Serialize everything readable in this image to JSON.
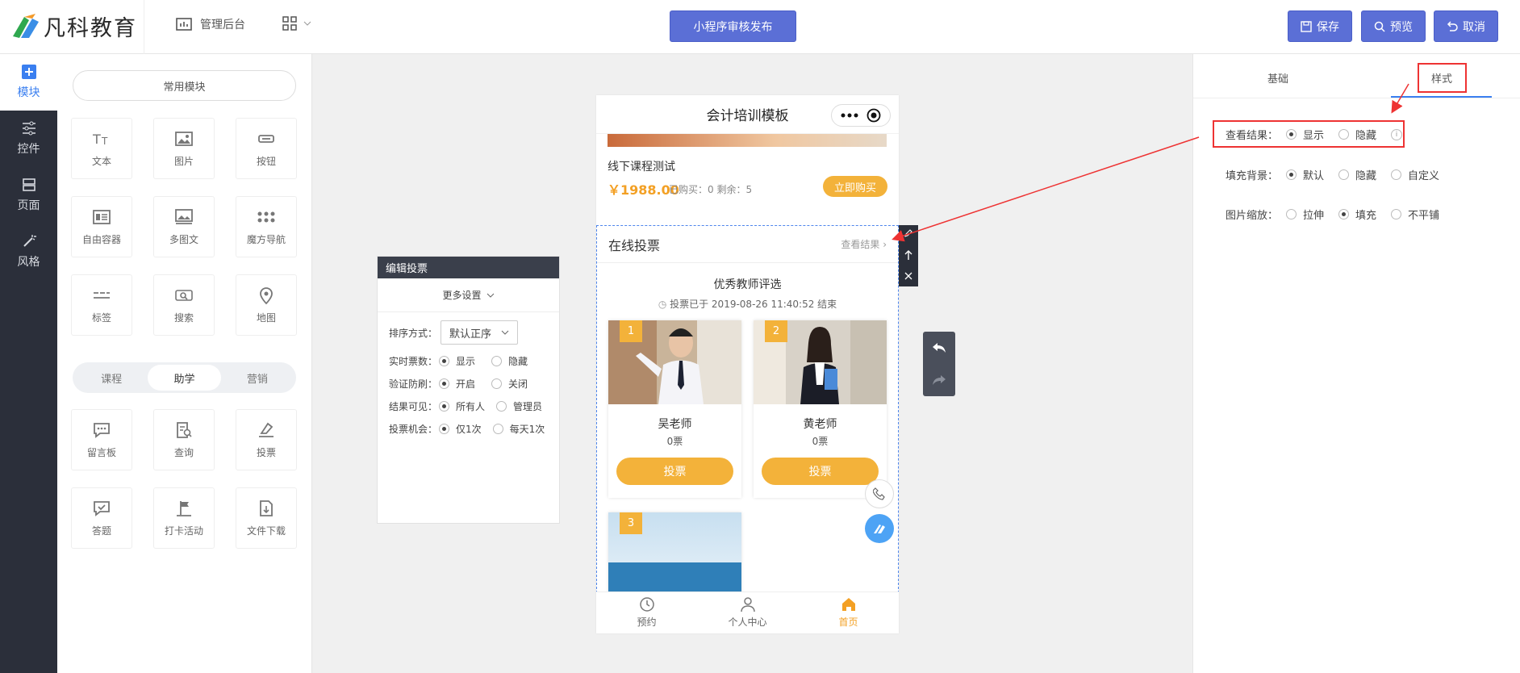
{
  "brand": {
    "name": "凡科教育"
  },
  "header": {
    "admin_label": "管理后台",
    "publish_label": "小程序审核发布",
    "save_label": "保存",
    "preview_label": "预览",
    "cancel_label": "取消"
  },
  "leftnav": [
    {
      "label": "模块",
      "icon": "plus-icon"
    },
    {
      "label": "控件",
      "icon": "sliders-icon"
    },
    {
      "label": "页面",
      "icon": "page-icon"
    },
    {
      "label": "风格",
      "icon": "magic-wand-icon"
    }
  ],
  "modules": {
    "common_label": "常用模块",
    "basic": [
      "文本",
      "图片",
      "按钮",
      "自由容器",
      "多图文",
      "魔方导航",
      "标签",
      "搜索",
      "地图"
    ],
    "tabs": [
      "课程",
      "助学",
      "营销"
    ],
    "active_tab": "助学",
    "extra": [
      "留言板",
      "查询",
      "投票",
      "答题",
      "打卡活动",
      "文件下载"
    ]
  },
  "editor": {
    "title": "编辑投票",
    "more": "更多设置",
    "sort_label": "排序方式：",
    "sort_value": "默认正序",
    "rows": [
      {
        "label": "实时票数：",
        "options": [
          "显示",
          "隐藏"
        ],
        "selected": 0
      },
      {
        "label": "验证防刷：",
        "options": [
          "开启",
          "关闭"
        ],
        "selected": 0
      },
      {
        "label": "结果可见：",
        "options": [
          "所有人",
          "管理员"
        ],
        "selected": 0
      },
      {
        "label": "投票机会：",
        "options": [
          "仅1次",
          "每天1次"
        ],
        "selected": 0
      }
    ]
  },
  "phone": {
    "title": "会计培训模板",
    "course": {
      "name": "线下课程测试",
      "price": "￥1988.00",
      "meta": "已购买：0 剩余：5",
      "buy": "立即购买"
    },
    "vote": {
      "header": "在线投票",
      "link": "查看结果",
      "title": "优秀教师评选",
      "time": "投票已于 2019-08-26 11:40:52 结束",
      "candidates": [
        {
          "num": "1",
          "name": "吴老师",
          "votes": "0票",
          "btn": "投票"
        },
        {
          "num": "2",
          "name": "黄老师",
          "votes": "0票",
          "btn": "投票"
        },
        {
          "num": "3"
        }
      ]
    },
    "tabbar": [
      {
        "label": "预约"
      },
      {
        "label": "个人中心"
      },
      {
        "label": "首页"
      }
    ]
  },
  "rightpanel": {
    "tabs": [
      "基础",
      "样式"
    ],
    "active_tab": "样式",
    "rows": [
      {
        "label": "查看结果：",
        "options": [
          "显示",
          "隐藏"
        ],
        "selected": 0
      },
      {
        "label": "填充背景：",
        "options": [
          "默认",
          "隐藏",
          "自定义"
        ],
        "selected": 0
      },
      {
        "label": "图片缩放：",
        "options": [
          "拉伸",
          "填充",
          "不平铺"
        ],
        "selected": 1
      }
    ]
  },
  "colors": {
    "accent": "#5b6fd6",
    "vote": "#f3b23a",
    "dark": "#2b2f3a",
    "highlight": "#e33333"
  }
}
